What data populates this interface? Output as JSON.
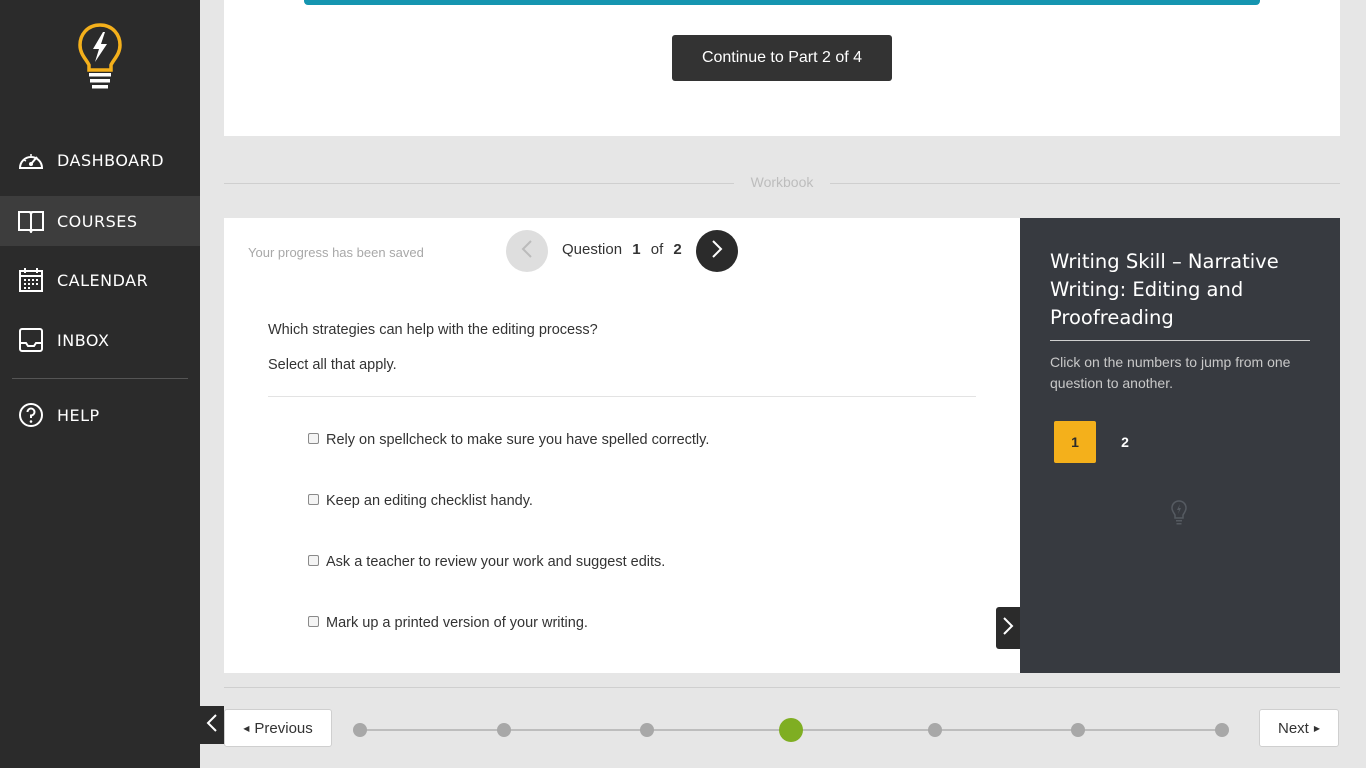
{
  "sidebar": {
    "logo": "lightbulb-logo",
    "items": [
      {
        "label": "DASHBOARD",
        "icon": "speedometer-icon",
        "active": false
      },
      {
        "label": "COURSES",
        "icon": "book-icon",
        "active": true
      },
      {
        "label": "CALENDAR",
        "icon": "calendar-icon",
        "active": false
      },
      {
        "label": "INBOX",
        "icon": "inbox-icon",
        "active": false
      },
      {
        "label": "HELP",
        "icon": "help-icon",
        "active": false
      }
    ]
  },
  "lesson": {
    "continue_label": "Continue to Part 2 of 4",
    "accent_color": "#1595b0"
  },
  "workbook": {
    "section_label": "Workbook",
    "saved_status": "Your progress has been saved",
    "question_label": "Question",
    "current_question": "1",
    "of_label": "of",
    "total_questions": "2",
    "question_text": "Which strategies can help with the editing process?",
    "instruction": "Select all that apply.",
    "options": [
      {
        "label": "Rely on spellcheck to make sure you have spelled correctly.",
        "checked": false
      },
      {
        "label": "Keep an editing checklist handy.",
        "checked": false
      },
      {
        "label": "Ask a teacher to review your work and suggest edits.",
        "checked": false
      },
      {
        "label": "Mark up a printed version of your writing.",
        "checked": false
      }
    ]
  },
  "panel": {
    "title": "Writing Skill – Narrative Writing: Editing and Proofreading",
    "help_text": "Click on the numbers to jump from one question to another.",
    "question_numbers": [
      "1",
      "2"
    ],
    "active_number": "1",
    "active_color": "#f4b01b"
  },
  "pager": {
    "previous_label": "Previous",
    "next_label": "Next",
    "step_count": 7,
    "current_step": 4,
    "current_color": "#7fae22"
  }
}
